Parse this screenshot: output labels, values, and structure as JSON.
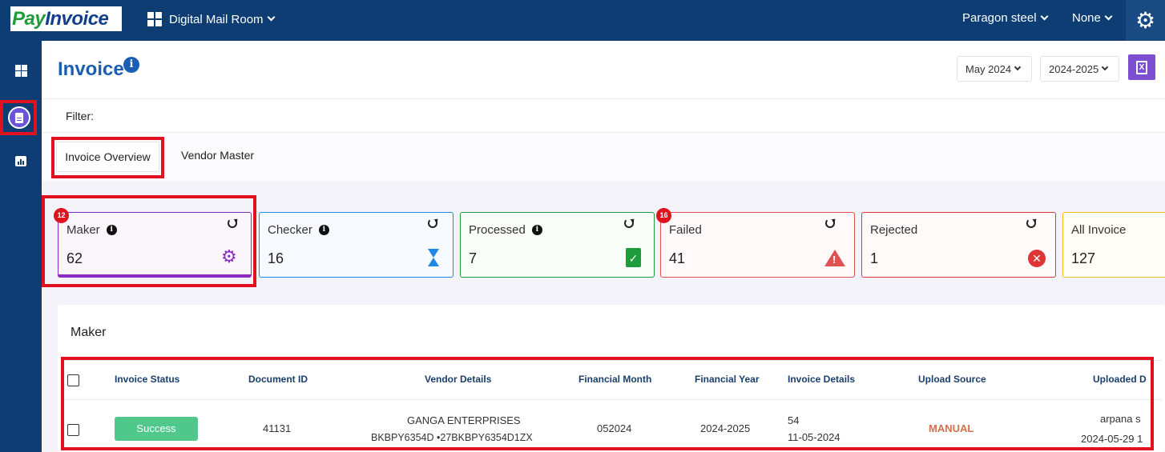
{
  "topbar": {
    "logo_pay": "Pay",
    "logo_invoice": "Invoice",
    "app_name": "Digital Mail Room",
    "company": "Paragon steel",
    "selector": "None"
  },
  "page": {
    "title": "Invoice",
    "month_select": "May 2024",
    "year_select": "2024-2025",
    "filter_label": "Filter:"
  },
  "tabs": {
    "overview": "Invoice Overview",
    "vendor": "Vendor Master"
  },
  "cards": {
    "maker": {
      "label": "Maker",
      "count": "62",
      "badge": "12",
      "color": "#8e2bc4"
    },
    "checker": {
      "label": "Checker",
      "count": "16",
      "color": "#1e88e5"
    },
    "processed": {
      "label": "Processed",
      "count": "7",
      "color": "#1e9b3a"
    },
    "failed": {
      "label": "Failed",
      "count": "41",
      "badge": "16",
      "color": "#e05252"
    },
    "rejected": {
      "label": "Rejected",
      "count": "1",
      "color": "#e03535"
    },
    "all": {
      "label": "All Invoice",
      "count": "127",
      "color": "#f2c21b"
    }
  },
  "panel": {
    "title": "Maker"
  },
  "table": {
    "headers": [
      "Invoice Status",
      "Document ID",
      "Vendor Details",
      "Financial Month",
      "Financial Year",
      "Invoice Details",
      "Upload Source",
      "Uploaded D"
    ],
    "rows": [
      {
        "status": "Success",
        "document_id": "41131",
        "vendor_name": "GANGA ENTERPRISES",
        "vendor_ids": "BKBPY6354D  •27BKBPY6354D1ZX",
        "financial_month": "052024",
        "financial_year": "2024-2025",
        "invoice_no": "54",
        "invoice_date": "11-05-2024",
        "upload_source": "MANUAL",
        "uploaded_by": "arpana s",
        "uploaded_at": "2024-05-29 1"
      }
    ]
  },
  "icons": {
    "settings": "gear-icon",
    "dashboard": "dashboard-grid-icon",
    "invoice_doc": "document-icon",
    "reports": "bar-chart-icon",
    "excel": "excel-export-icon"
  },
  "colors": {
    "topbar": "#0e3d73",
    "title_blue": "#1a5fb4",
    "highlight_red": "#e0121f",
    "success": "#4ec98b",
    "manual": "#d0704d"
  }
}
